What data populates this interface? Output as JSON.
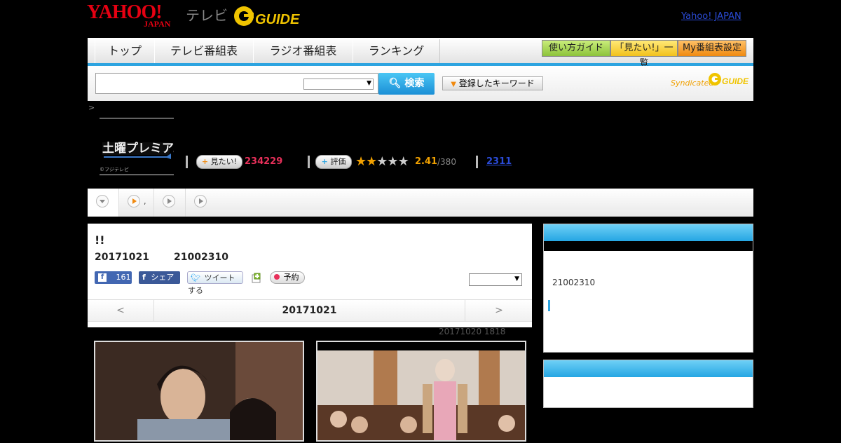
{
  "header": {
    "logo_yahoo": "YAHOO!",
    "logo_japan": "JAPAN",
    "logo_tv": "テレビ",
    "logo_gguide": "GUIDE",
    "yahoo_japan_link": "Yahoo! JAPAN"
  },
  "nav": {
    "tabs": [
      "トップ",
      "テレビ番組表",
      "ラジオ番組表",
      "ランキング"
    ],
    "guide_buttons": [
      "使い方ガイド",
      "「見たい!」一覧",
      "My番組表設定"
    ]
  },
  "search": {
    "button_label": "検索",
    "keyword_button": "登録したキーワード",
    "syndicated": "Syndicated",
    "syndicated_logo": "GUIDE"
  },
  "breadcrumb": ">",
  "program": {
    "logo_caption": "©フジテレビ",
    "want_label": "見たい!",
    "want_count": "234229",
    "rate_label": "評価",
    "rating": "2.41",
    "rating_votes": "/380",
    "rating_stars": 2.41,
    "link_count": "2311"
  },
  "tabs_row": {
    "second_tab_label": ","
  },
  "main": {
    "title": "!!",
    "date": "20171021",
    "episode": "21002310",
    "fb_like_count": "161",
    "fb_share": "シェア",
    "tweet": "ツイートする",
    "reserve": "予約",
    "pager_prev": "<",
    "pager_date": "20171021",
    "pager_next": ">",
    "updated": "20171020  1818"
  },
  "sidebar": {
    "episode_text": "21002310"
  },
  "colors": {
    "accent": "#2da4e0",
    "want_count": "#e8305a",
    "rating": "#f0a000",
    "link": "#2a4bd7"
  }
}
